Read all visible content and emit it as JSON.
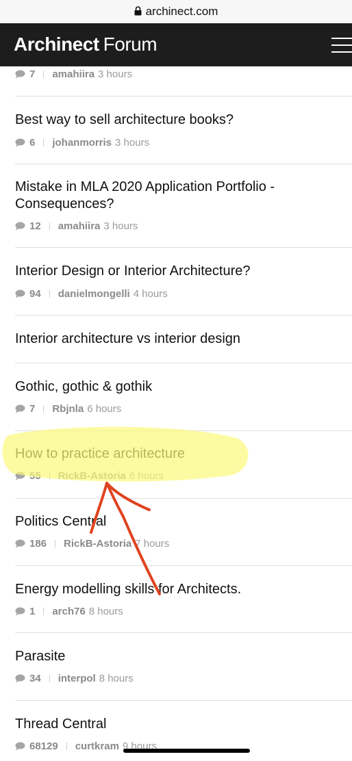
{
  "browser": {
    "url": "archinect.com"
  },
  "header": {
    "brand_strong": "Archinect",
    "brand_light": "Forum",
    "menu_icon": "hamburger-menu-icon"
  },
  "threads": [
    {
      "title": "",
      "count": "7",
      "author": "amahiira",
      "time": "3 hours"
    },
    {
      "title": "Best way to sell architecture books?",
      "count": "6",
      "author": "johanmorris",
      "time": "3 hours"
    },
    {
      "title": "Mistake in MLA 2020 Application Portfolio - Consequences?",
      "count": "12",
      "author": "amahiira",
      "time": "3 hours"
    },
    {
      "title": "Interior Design or Interior Architecture?",
      "count": "94",
      "author": "danielmongelli",
      "time": "4 hours"
    },
    {
      "title": "Interior architecture vs interior design",
      "count": "",
      "author": "",
      "time": ""
    },
    {
      "title": "Gothic, gothic & gothik",
      "count": "7",
      "author": "Rbjnla",
      "time": "6 hours"
    },
    {
      "title": "How to practice architecture",
      "count": "55",
      "author": "RickB-Astoria",
      "time": "6 hours"
    },
    {
      "title": "Politics Central",
      "count": "186",
      "author": "RickB-Astoria",
      "time": "7 hours"
    },
    {
      "title": "Energy modelling skills for Architects.",
      "count": "1",
      "author": "arch76",
      "time": "8 hours"
    },
    {
      "title": "Parasite",
      "count": "34",
      "author": "interpol",
      "time": "8 hours"
    },
    {
      "title": "Thread Central",
      "count": "68129",
      "author": "curtkram",
      "time": "9 hours"
    }
  ],
  "colors": {
    "header_bg": "#1d1d1d",
    "highlight": "#fbf97a",
    "arrow": "#e0431f"
  }
}
